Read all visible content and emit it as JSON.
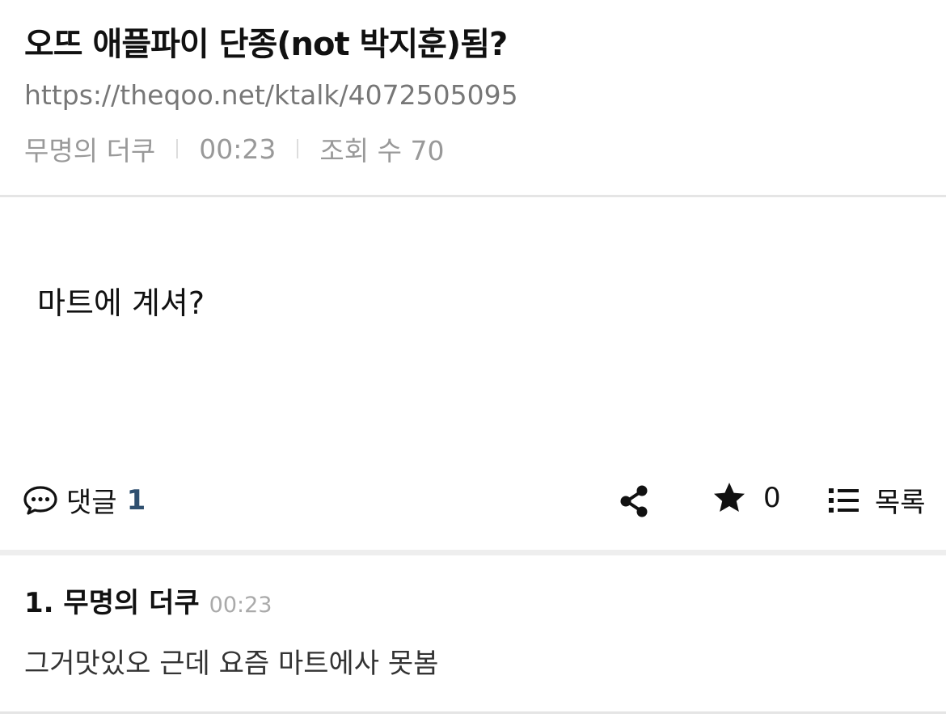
{
  "post": {
    "title": "오뜨 애플파이 단종(not 박지훈)됨?",
    "url": "https://theqoo.net/ktalk/4072505095",
    "author": "무명의 더쿠",
    "time": "00:23",
    "views_label": "조회 수 70",
    "body": "마트에 계셔?"
  },
  "actions": {
    "comment_label": "댓글",
    "comment_count": "1",
    "star_count": "0",
    "list_label": "목록",
    "icons": {
      "comment": "speech-bubble-icon",
      "share": "share-icon",
      "star": "star-icon",
      "list": "list-icon"
    }
  },
  "comments": [
    {
      "author": "1. 무명의 더쿠",
      "time": "00:23",
      "text": "그거맛있오 근데 요즘 마트에사 못봄"
    }
  ],
  "colors": {
    "comment_count": "#2f4f6f",
    "meta_text": "#999999",
    "divider": "#e5e5e5"
  }
}
